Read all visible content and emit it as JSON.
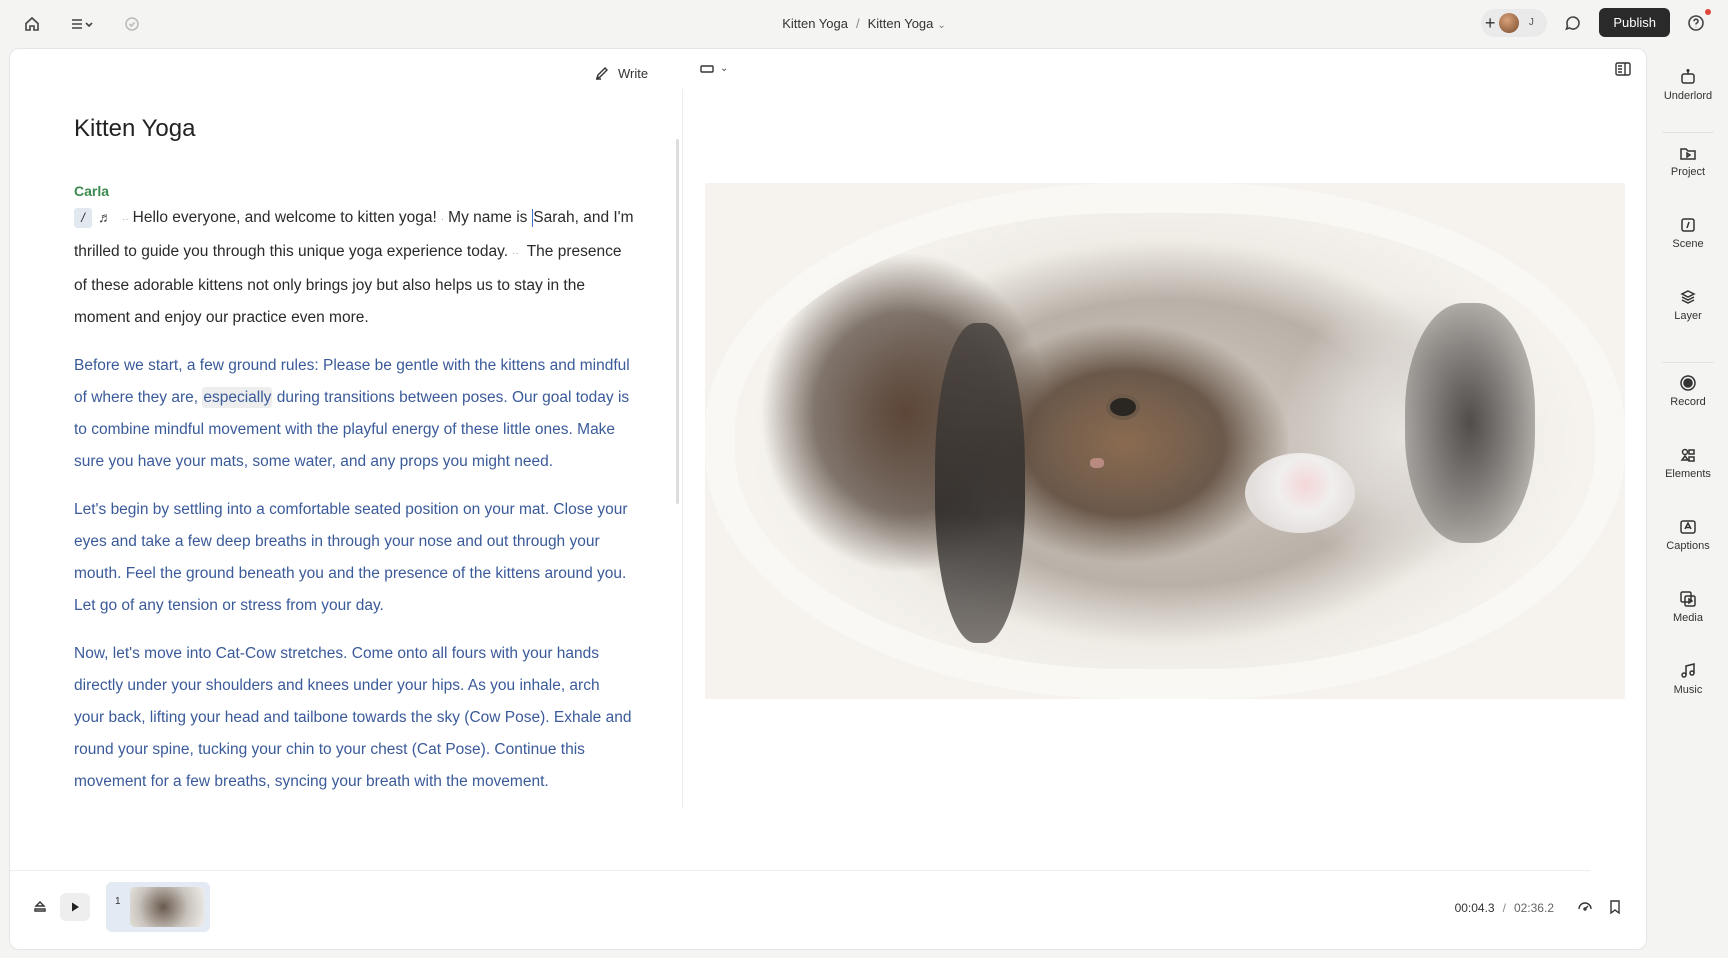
{
  "header": {
    "breadcrumb_project": "Kitten Yoga",
    "breadcrumb_sep": "/",
    "breadcrumb_file": "Kitten Yoga",
    "collaborator_initial": "J",
    "publish_label": "Publish"
  },
  "toolbar": {
    "write_label": "Write"
  },
  "sidebar": {
    "items": [
      {
        "label": "Underlord",
        "icon": "robot-icon"
      },
      {
        "label": "Project",
        "icon": "folder-play-icon"
      },
      {
        "label": "Scene",
        "icon": "scene-icon"
      },
      {
        "label": "Layer",
        "icon": "layers-icon"
      },
      {
        "label": "Record",
        "icon": "record-icon"
      },
      {
        "label": "Elements",
        "icon": "elements-icon"
      },
      {
        "label": "Captions",
        "icon": "captions-icon"
      },
      {
        "label": "Media",
        "icon": "media-icon"
      },
      {
        "label": "Music",
        "icon": "music-icon"
      }
    ]
  },
  "script": {
    "title": "Kitten Yoga",
    "speaker": "Carla",
    "slash": "/",
    "p1_a": "Hello everyone, and welcome to kitten yoga!",
    "p1_b": "My name is ",
    "p1_c": "Sarah, and I'm thrilled to guide you through this unique yoga experience today.",
    "p1_d": "The presence of these adorable kittens not only brings joy but also helps us to stay in the moment and enjoy our practice even more.",
    "p2_a": "Before we start, a few ground rules: Please be gentle with the kittens and mindful of where they are, ",
    "p2_hl": "especially",
    "p2_b": " during transitions between poses. Our goal today is to combine mindful movement with the playful energy of these little ones. Make sure you have your mats, some water, and any props you might need.",
    "p3": "Let's begin by settling into a comfortable seated position on your mat. Close your eyes and take a few deep breaths in through your nose and out through your mouth. Feel the ground beneath you and the presence of the kittens around you. Let go of any tension or stress from your day.",
    "p4": "Now, let's move into Cat-Cow stretches. Come onto all fours with your hands directly under your shoulders and knees under your hips. As you inhale, arch your back, lifting your head and tailbone towards the sky (Cow Pose). Exhale and round your spine, tucking your chin to your chest (Cat Pose). Continue this movement for a few breaths, syncing your breath with the movement."
  },
  "timeline": {
    "scene_number": "1",
    "current_time": "00:04.3",
    "time_sep": "/",
    "duration": "02:36.2"
  }
}
